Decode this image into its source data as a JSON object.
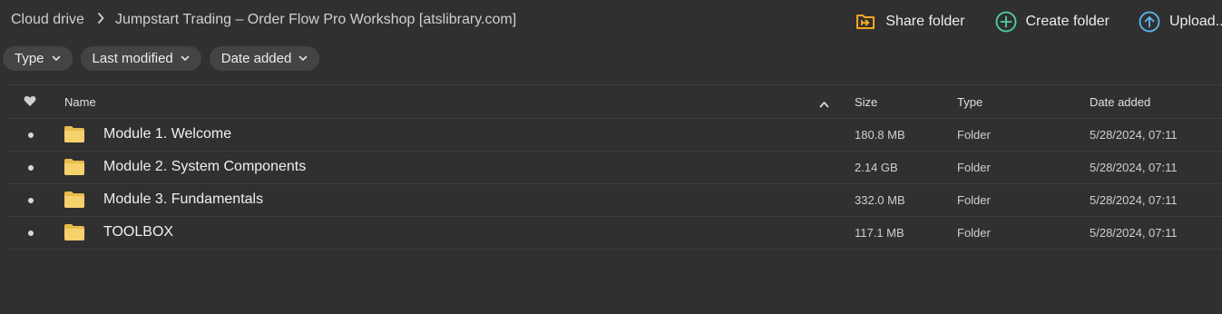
{
  "breadcrumb": {
    "root": "Cloud drive",
    "current": "Jumpstart Trading – Order Flow Pro Workshop [atslibrary.com]"
  },
  "actions": {
    "share": "Share folder",
    "create": "Create folder",
    "upload": "Upload..."
  },
  "filters": [
    {
      "label": "Type"
    },
    {
      "label": "Last modified"
    },
    {
      "label": "Date added"
    }
  ],
  "columns": {
    "name": "Name",
    "size": "Size",
    "type": "Type",
    "date_added": "Date added"
  },
  "rows": [
    {
      "name": "Module 1. Welcome",
      "size": "180.8 MB",
      "type": "Folder",
      "date_added": "5/28/2024, 07:11"
    },
    {
      "name": "Module 2. System Components",
      "size": "2.14 GB",
      "type": "Folder",
      "date_added": "5/28/2024, 07:11"
    },
    {
      "name": "Module 3. Fundamentals",
      "size": "332.0 MB",
      "type": "Folder",
      "date_added": "5/28/2024, 07:11"
    },
    {
      "name": "TOOLBOX",
      "size": "117.1 MB",
      "type": "Folder",
      "date_added": "5/28/2024, 07:11"
    }
  ],
  "icons": {
    "share": "share-folder-icon",
    "create": "plus-circle-icon",
    "upload": "upload-arrow-icon",
    "folder": "folder-icon",
    "favourite": "heart-icon",
    "sort": "chevron-up-icon"
  },
  "colors": {
    "background": "#303030",
    "share_accent": "#f5a623",
    "create_accent": "#4ed3a0",
    "upload_accent": "#5bb8f0",
    "folder": "#f6d16e"
  }
}
